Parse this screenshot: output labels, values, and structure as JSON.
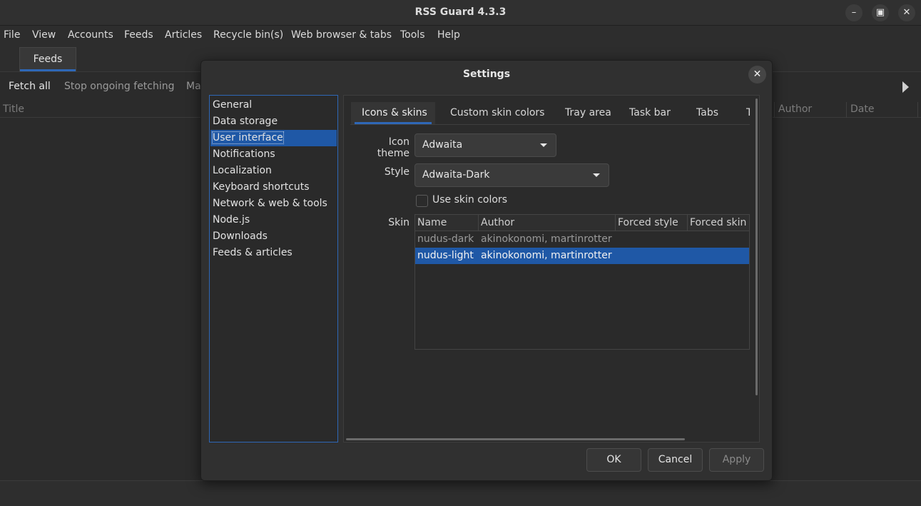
{
  "window": {
    "title": "RSS Guard 4.3.3",
    "minimize_icon": "minimize-icon",
    "maximize_icon": "maximize-icon",
    "close_icon": "close-icon"
  },
  "menubar": [
    "File",
    "View",
    "Accounts",
    "Feeds",
    "Articles",
    "Recycle bin(s)",
    "Web browser & tabs",
    "Tools",
    "Help"
  ],
  "main_tab": "Feeds",
  "toolbar": {
    "fetch_all": "Fetch all",
    "stop_fetching": "Stop ongoing fetching",
    "truncated": "Ma"
  },
  "columns": {
    "title": "Title",
    "author": "Author",
    "date": "Date"
  },
  "dialog": {
    "title": "Settings",
    "categories": [
      "General",
      "Data storage",
      "User interface",
      "Notifications",
      "Localization",
      "Keyboard shortcuts",
      "Network & web & tools",
      "Node.js",
      "Downloads",
      "Feeds & articles"
    ],
    "selected_category": "User interface",
    "tabs": [
      "Icons & skins",
      "Custom skin colors",
      "Tray area",
      "Task bar",
      "Tabs",
      "T"
    ],
    "icon_theme_label": "Icon theme",
    "icon_theme_value": "Adwaita",
    "style_label": "Style",
    "style_value": "Adwaita-Dark",
    "use_skin_colors_label": "Use skin colors",
    "use_skin_colors_checked": false,
    "skin_label": "Skin",
    "skin_table": {
      "headers": [
        "Name",
        "Author",
        "Forced style",
        "Forced skin c"
      ],
      "rows": [
        {
          "name": "nudus-dark",
          "author": "akinokonomi, martinrotter"
        },
        {
          "name": "nudus-light",
          "author": "akinokonomi, martinrotter"
        }
      ],
      "selected_row": "nudus-light"
    },
    "buttons": {
      "ok": "OK",
      "cancel": "Cancel",
      "apply": "Apply"
    }
  },
  "colors": {
    "accent": "#2e67b7",
    "selection": "#1f58a6",
    "background": "#2b2b2b"
  }
}
